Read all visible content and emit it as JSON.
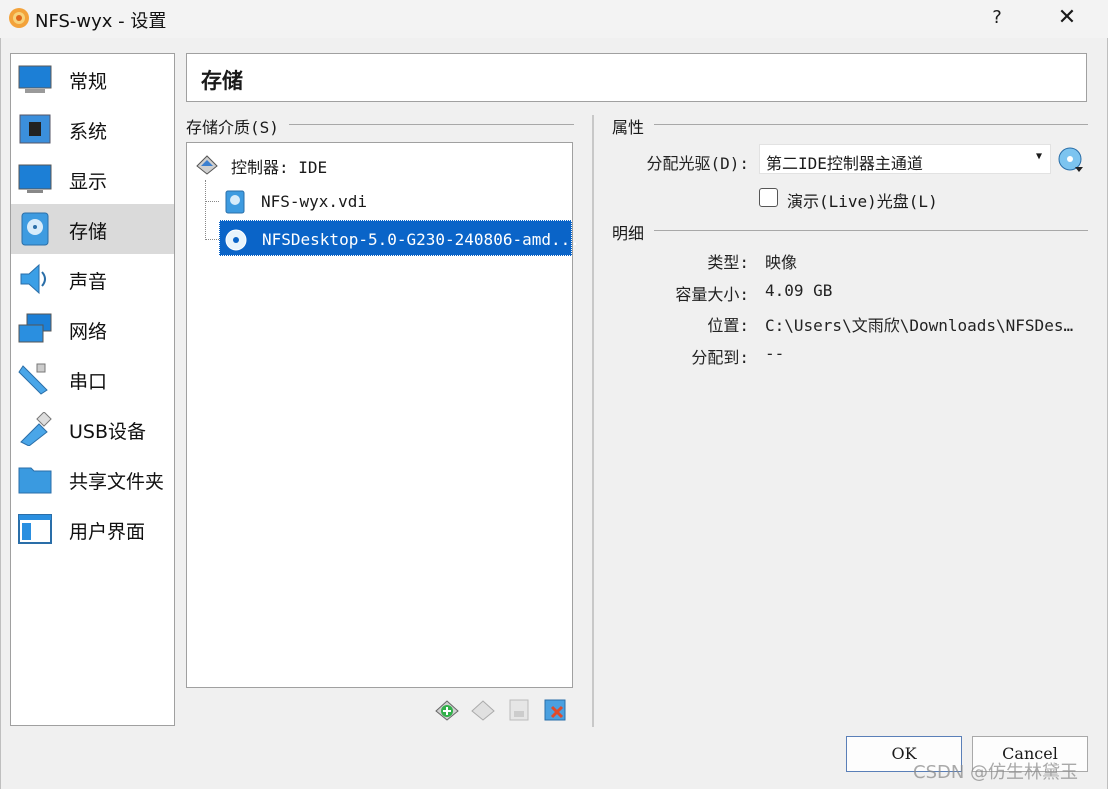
{
  "window": {
    "title": "NFS-wyx - 设置",
    "help_label": "?",
    "close_label": "✕"
  },
  "sidebar": {
    "items": [
      {
        "label": "常规",
        "icon": "general-icon"
      },
      {
        "label": "系统",
        "icon": "system-icon"
      },
      {
        "label": "显示",
        "icon": "display-icon"
      },
      {
        "label": "存储",
        "icon": "storage-icon",
        "active": true
      },
      {
        "label": "声音",
        "icon": "audio-icon"
      },
      {
        "label": "网络",
        "icon": "network-icon"
      },
      {
        "label": "串口",
        "icon": "serial-port-icon"
      },
      {
        "label": "USB设备",
        "icon": "usb-icon"
      },
      {
        "label": "共享文件夹",
        "icon": "shared-folder-icon"
      },
      {
        "label": "用户界面",
        "icon": "user-interface-icon"
      }
    ]
  },
  "page": {
    "title": "存储"
  },
  "storage": {
    "group_label": "存储介质(S)",
    "controller": "控制器: IDE",
    "disk": "NFS-wyx.vdi",
    "optical": "NFSDesktop-5.0-G230-240806-amd..."
  },
  "attributes": {
    "group_label": "属性",
    "drive_label": "分配光驱(D):",
    "drive_value": "第二IDE控制器主通道",
    "live_cd_label": "演示(Live)光盘(L)",
    "live_cd_checked": false
  },
  "details": {
    "group_label": "明细",
    "type_label": "类型:",
    "type_value": "映像",
    "size_label": "容量大小:",
    "size_value": "4.09  GB",
    "location_label": "位置:",
    "location_value": "C:\\Users\\文雨欣\\Downloads\\NFSDes…",
    "attached_label": "分配到:",
    "attached_value": "--"
  },
  "buttons": {
    "ok": "OK",
    "cancel": "Cancel"
  },
  "watermark": "CSDN @仿生林黛玉",
  "colors": {
    "selection": "#0a64c8",
    "accent": "#1e8ed8"
  }
}
